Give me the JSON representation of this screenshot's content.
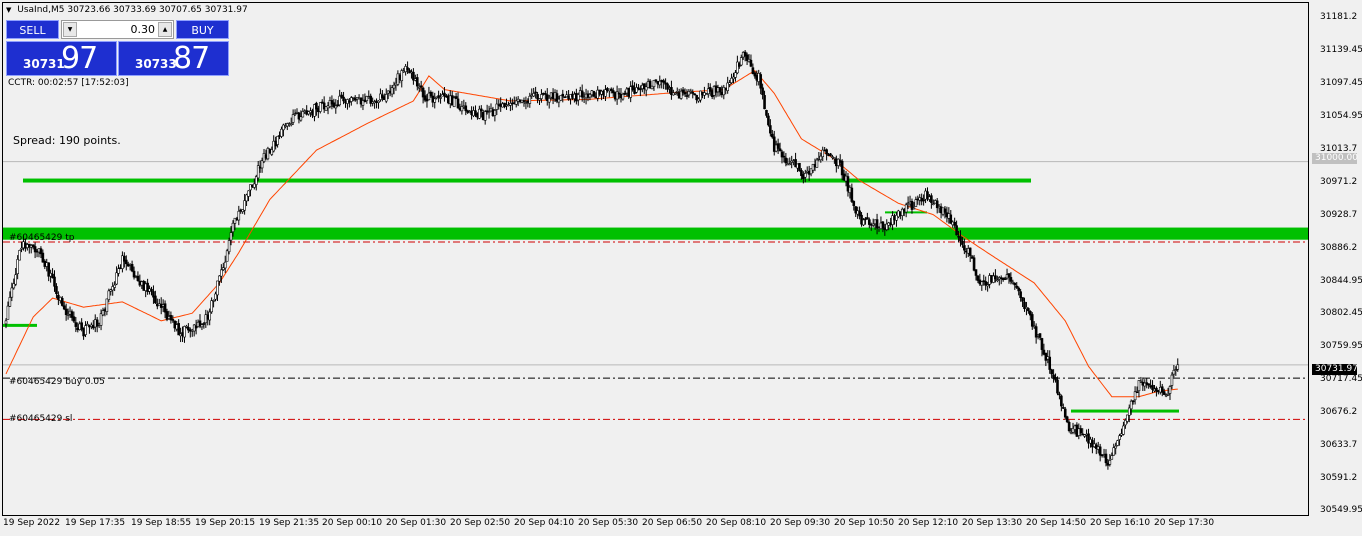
{
  "symbol_line": {
    "symbol": "UsaInd,M5",
    "ohlc": "30723.66 30733.69 30707.65 30731.97"
  },
  "trade_panel": {
    "sell_label": "SELL",
    "buy_label": "BUY",
    "lot_value": "0.30",
    "sell_price_small": "30731",
    "sell_price_big": "97",
    "buy_price_small": "30733",
    "buy_price_big": "87"
  },
  "cctr": "CCTR: 00:02:57 [17:52:03]",
  "spread": "Spread: 190 points.",
  "order_labels": {
    "tp": "#60465429 tp",
    "buy": "#60465429 buy 0.05",
    "sl": "#60465429 sl"
  },
  "colors": {
    "background": "#f0f0f0",
    "candle_body": "#000000",
    "candle_up_fill": "#ffffff",
    "ma_line": "#ff4500",
    "zone_green": "#00c000",
    "sl_tp_line": "#d00000",
    "panel_blue": "#1e2fd0"
  },
  "chart_data": {
    "type": "candlestick",
    "timeframe": "M5",
    "ylim": [
      30539.2,
      31192.0
    ],
    "y_ticks": [
      31181.2,
      31139.45,
      31097.45,
      31054.95,
      31013.7,
      30971.2,
      30928.7,
      30886.2,
      30844.95,
      30802.45,
      30759.95,
      30717.45,
      30676.2,
      30633.7,
      30591.2,
      30549.95
    ],
    "x_ticks": [
      "19 Sep 2022",
      "19 Sep 17:35",
      "19 Sep 18:55",
      "19 Sep 20:15",
      "19 Sep 21:35",
      "20 Sep 00:10",
      "20 Sep 01:30",
      "20 Sep 02:50",
      "20 Sep 04:10",
      "20 Sep 05:30",
      "20 Sep 06:50",
      "20 Sep 08:10",
      "20 Sep 09:30",
      "20 Sep 10:50",
      "20 Sep 12:10",
      "20 Sep 13:30",
      "20 Sep 14:50",
      "20 Sep 16:10",
      "20 Sep 17:30"
    ],
    "price_tags": {
      "current": "30731.97",
      "level": "31000.00"
    },
    "horizontal_levels": {
      "current_price": 30731.97,
      "level_31000": 31000.0,
      "buy_entry": 30714.5,
      "stop_loss": 30660.0,
      "take_profit": 30894.0
    },
    "zones": [
      {
        "from": "19 Sep 2022",
        "to": "20 Sep 13:30",
        "price": 30975.0,
        "kind": "line"
      },
      {
        "from": "19 Sep 2022",
        "to": "20 Sep 17:30+",
        "price_low": 30897.0,
        "price_high": 30913.0,
        "kind": "band"
      },
      {
        "from": "19 Sep 2022",
        "to": "19 Sep 17:35",
        "price": 30784.0,
        "kind": "line"
      },
      {
        "from": "20 Sep 10:50",
        "to": "20 Sep 12:10",
        "price": 30933.0,
        "kind": "line"
      },
      {
        "from": "20 Sep 14:50",
        "to": "20 Sep 17:30+",
        "price": 30671.0,
        "kind": "line"
      }
    ],
    "close_anchors": [
      [
        0,
        30790
      ],
      [
        8,
        30890
      ],
      [
        18,
        30880
      ],
      [
        28,
        30815
      ],
      [
        40,
        30775
      ],
      [
        48,
        30790
      ],
      [
        60,
        30870
      ],
      [
        78,
        30815
      ],
      [
        90,
        30775
      ],
      [
        104,
        30795
      ],
      [
        112,
        30860
      ],
      [
        116,
        30910
      ],
      [
        132,
        31000
      ],
      [
        146,
        31055
      ],
      [
        170,
        31080
      ],
      [
        196,
        31085
      ],
      [
        206,
        31125
      ],
      [
        216,
        31085
      ],
      [
        230,
        31080
      ],
      [
        246,
        31060
      ],
      [
        260,
        31080
      ],
      [
        280,
        31085
      ],
      [
        320,
        31090
      ],
      [
        336,
        31105
      ],
      [
        350,
        31085
      ],
      [
        370,
        31095
      ],
      [
        380,
        31140
      ],
      [
        388,
        31110
      ],
      [
        396,
        31020
      ],
      [
        404,
        31000
      ],
      [
        412,
        30980
      ],
      [
        422,
        31015
      ],
      [
        430,
        30995
      ],
      [
        440,
        30925
      ],
      [
        452,
        30915
      ],
      [
        462,
        30935
      ],
      [
        474,
        30955
      ],
      [
        488,
        30920
      ],
      [
        496,
        30880
      ],
      [
        502,
        30840
      ],
      [
        516,
        30850
      ],
      [
        526,
        30805
      ],
      [
        538,
        30730
      ],
      [
        548,
        30650
      ],
      [
        560,
        30630
      ],
      [
        568,
        30600
      ],
      [
        572,
        30625
      ],
      [
        584,
        30705
      ],
      [
        590,
        30705
      ],
      [
        598,
        30692
      ],
      [
        604,
        30732
      ]
    ],
    "ma_anchors": [
      [
        0,
        30720
      ],
      [
        14,
        30795
      ],
      [
        24,
        30820
      ],
      [
        40,
        30808
      ],
      [
        60,
        30815
      ],
      [
        80,
        30790
      ],
      [
        96,
        30800
      ],
      [
        110,
        30840
      ],
      [
        120,
        30880
      ],
      [
        136,
        30950
      ],
      [
        160,
        31015
      ],
      [
        186,
        31050
      ],
      [
        210,
        31080
      ],
      [
        218,
        31113
      ],
      [
        226,
        31095
      ],
      [
        260,
        31080
      ],
      [
        300,
        31082
      ],
      [
        340,
        31090
      ],
      [
        370,
        31095
      ],
      [
        386,
        31120
      ],
      [
        396,
        31090
      ],
      [
        410,
        31030
      ],
      [
        426,
        31005
      ],
      [
        440,
        30975
      ],
      [
        460,
        30945
      ],
      [
        478,
        30930
      ],
      [
        494,
        30900
      ],
      [
        510,
        30873
      ],
      [
        530,
        30840
      ],
      [
        546,
        30790
      ],
      [
        558,
        30730
      ],
      [
        570,
        30690
      ],
      [
        584,
        30690
      ],
      [
        594,
        30697
      ],
      [
        604,
        30700
      ]
    ]
  }
}
